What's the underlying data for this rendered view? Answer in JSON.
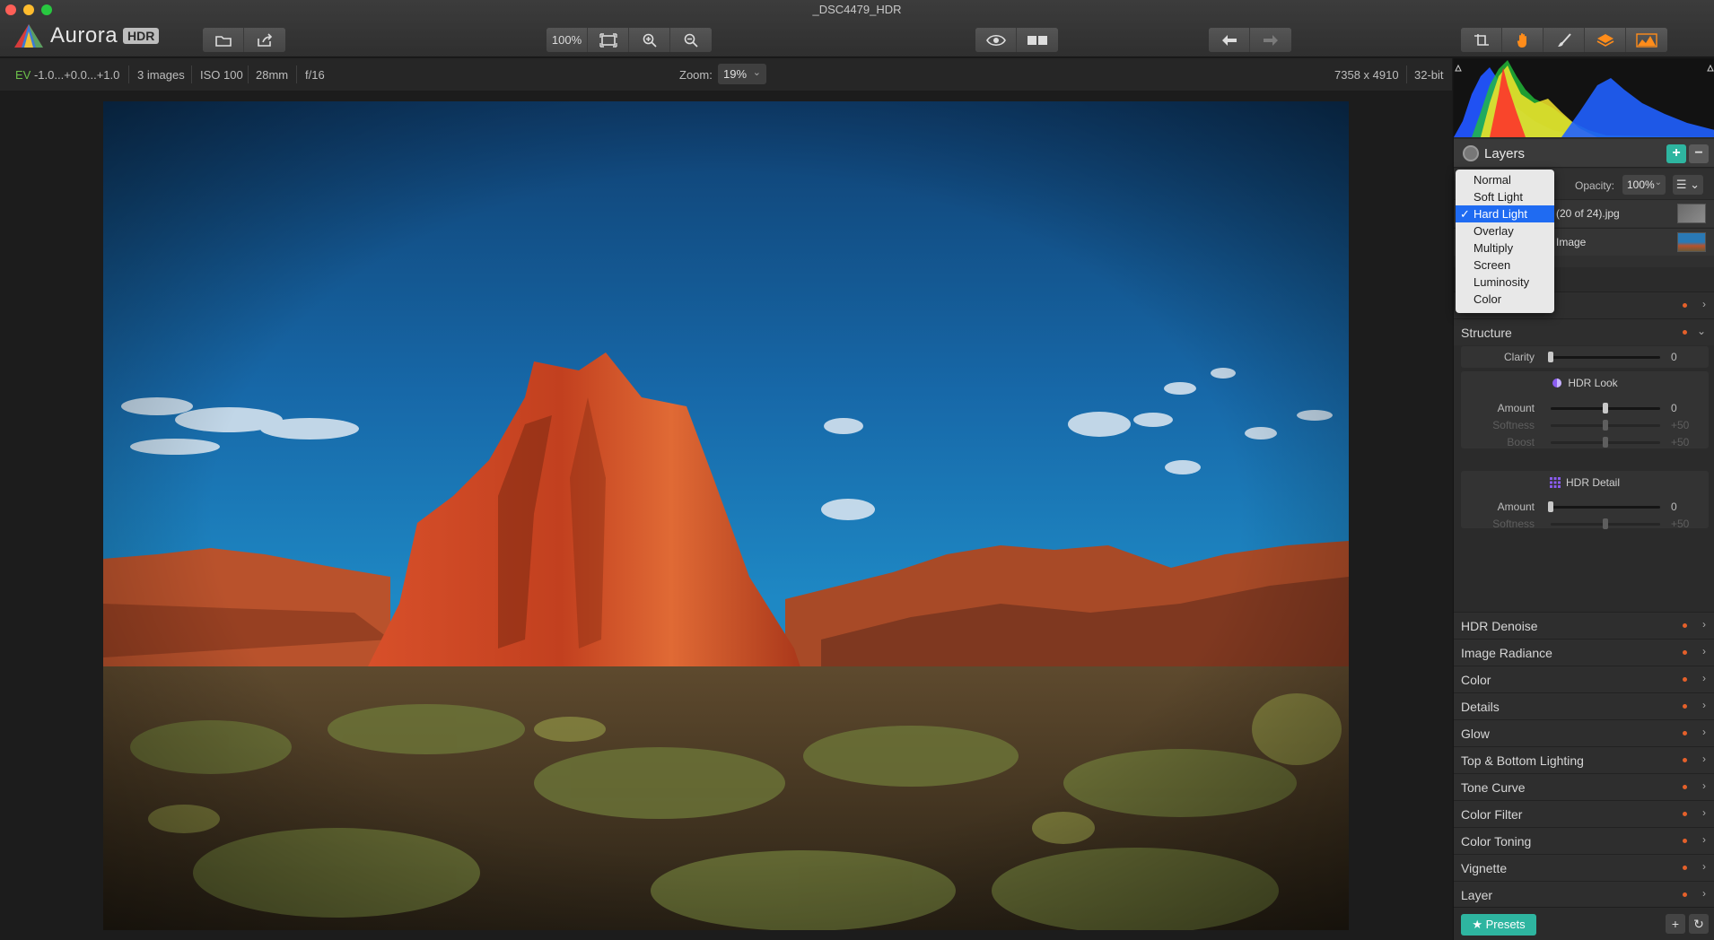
{
  "window": {
    "title": "_DSC4479_HDR"
  },
  "app": {
    "name": "Aurora",
    "badge": "HDR"
  },
  "toolbar": {
    "zoom_label": "100%",
    "icons": [
      "open-file-icon",
      "share-icon",
      "fit-screen-icon",
      "zoom-in-icon",
      "zoom-out-icon",
      "preview-eye-icon",
      "compare-icon",
      "undo-icon",
      "redo-icon",
      "crop-transform-icon",
      "hand-tool-icon",
      "brush-icon",
      "layers-icon",
      "histogram-icon"
    ]
  },
  "info": {
    "ev_label": "EV",
    "ev_value": "-1.0...+0.0...+1.0",
    "images": "3 images",
    "iso": "ISO 100",
    "focal": "28mm",
    "aperture": "f/16",
    "zoom_label": "Zoom:",
    "zoom_value": "19%",
    "dimensions": "7358 x 4910",
    "bit_depth": "32-bit"
  },
  "layers": {
    "title": "Layers",
    "opacity_label": "Opacity:",
    "opacity_value": "100%",
    "rows": [
      {
        "name": "(20 of 24).jpg"
      },
      {
        "name": "Image"
      }
    ],
    "blend_modes": [
      "Normal",
      "Soft Light",
      "Hard Light",
      "Overlay",
      "Multiply",
      "Screen",
      "Luminosity",
      "Color"
    ],
    "selected_blend": "Hard Light"
  },
  "structure": {
    "title": "Structure",
    "clarity": {
      "label": "Clarity",
      "value": "0",
      "level": 0
    },
    "hdr_look": {
      "title": "HDR Look",
      "amount": {
        "label": "Amount",
        "value": "0",
        "level": 0.5
      },
      "softness": {
        "label": "Softness",
        "value": "+50",
        "level": 0.5
      },
      "boost": {
        "label": "Boost",
        "value": "+50",
        "level": 0.5
      }
    },
    "hdr_detail": {
      "title": "HDR Detail",
      "amount": {
        "label": "Amount",
        "value": "0",
        "level": 0
      },
      "softness": {
        "label": "Softness",
        "value": "+50",
        "level": 0.5
      }
    }
  },
  "sections": [
    "HDR Denoise",
    "Image Radiance",
    "Color",
    "Details",
    "Glow",
    "Top & Bottom Lighting",
    "Tone Curve",
    "Color Filter",
    "Color Toning",
    "Vignette",
    "Layer"
  ],
  "footer": {
    "presets_label": "Presets"
  },
  "colors": {
    "accent_teal": "#2eb5a0",
    "status_orange": "#e5602a",
    "menu_selection": "#1f6bf2"
  }
}
